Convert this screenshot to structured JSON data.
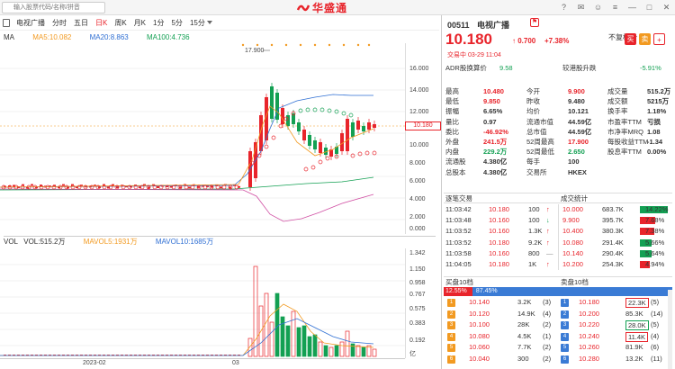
{
  "search": {
    "placeholder": "输入股票代码/名称/拼音"
  },
  "brand": {
    "name": "华盛通",
    "color": "#e8242b"
  },
  "toolbar": {
    "stock": "电视广播",
    "items": [
      "分时",
      "五日",
      "日K",
      "周K",
      "月K",
      "1分",
      "5分",
      "15分"
    ],
    "active": "日K"
  },
  "ma": {
    "label": "MA",
    "ma5": "MA5:10.082",
    "ma20": "MA20:8.863",
    "ma100": "MA100:4.736",
    "fq": "不复权"
  },
  "vol": {
    "label": "VOL",
    "vol": "VOL:515.2万",
    "mavol5": "MAVOL5:1931万",
    "mavol10": "MAVOL10:1685万"
  },
  "price_axis": [
    "16.000",
    "14.000",
    "12.000",
    "10.000",
    "8.000",
    "6.000",
    "4.000",
    "2.000",
    "0.000"
  ],
  "vol_axis": [
    "1.342",
    "1.150",
    "0.958",
    "0.767",
    "0.575",
    "0.383",
    "0.192",
    "亿"
  ],
  "crosshair_price": "10.180",
  "peak_label": "17.900",
  "dates": [
    "2023-02",
    "03"
  ],
  "colors": {
    "up": "#e8242b",
    "down": "#13a053",
    "ma5": "#f29a21",
    "ma20": "#2f6fd3",
    "ma100": "#13a053"
  },
  "panel": {
    "code": "00511",
    "name": "电视广播",
    "price": "10.180",
    "change": "0.700",
    "pct": "+7.38%",
    "time": "交易中 03-29 11:04",
    "adr_label": "ADR股换算价",
    "adr_value": "9.58",
    "adr_cmp_label": "较港股升跌",
    "adr_cmp_value": "-5.91%",
    "stats": [
      [
        "最高",
        "10.480",
        "今开",
        "9.900",
        "成交量",
        "515.2万"
      ],
      [
        "最低",
        "9.850",
        "昨收",
        "9.480",
        "成交额",
        "5215万"
      ],
      [
        "振幅",
        "6.65%",
        "均价",
        "10.121",
        "换手率",
        "1.18%"
      ],
      [
        "量比",
        "0.97",
        "流通市值",
        "44.59亿",
        "市盈率TTM",
        "亏损"
      ],
      [
        "委比",
        "-46.92%",
        "总市值",
        "44.59亿",
        "市净率MRQ",
        "1.08"
      ],
      [
        "外盘",
        "241.5万",
        "52周最高",
        "17.900",
        "每股收益TTM",
        "-1.34"
      ],
      [
        "内盘",
        "229.2万",
        "52周最低",
        "2.650",
        "股息率TTM",
        "0.00%"
      ],
      [
        "流通股",
        "4.380亿",
        "每手",
        "100",
        "",
        ""
      ],
      [
        "总股本",
        "4.380亿",
        "交易所",
        "HKEX",
        "",
        ""
      ]
    ],
    "trades_title": "逐笔交易",
    "tstats_title": "成交统计",
    "trades": [
      [
        "11:03:42",
        "10.180",
        "100",
        "up"
      ],
      [
        "11:03:48",
        "10.160",
        "100",
        "down"
      ],
      [
        "11:03:52",
        "10.160",
        "1.3K",
        "up"
      ],
      [
        "11:03:52",
        "10.180",
        "9.2K",
        "up"
      ],
      [
        "11:03:58",
        "10.160",
        "800",
        "flat"
      ],
      [
        "11:04:05",
        "10.180",
        "1K",
        "up"
      ]
    ],
    "tstats": [
      [
        "10.000",
        "683.7K",
        "14.22%",
        0.9
      ],
      [
        "9.900",
        "395.7K",
        "7.68%",
        0.5
      ],
      [
        "10.400",
        "380.3K",
        "7.38%",
        0.48
      ],
      [
        "10.080",
        "291.4K",
        "5.66%",
        0.37
      ],
      [
        "10.140",
        "290.4K",
        "5.64%",
        0.37
      ],
      [
        "10.200",
        "254.3K",
        "4.94%",
        0.32
      ]
    ],
    "buy_title": "买盘10档",
    "sell_title": "卖盘10档",
    "buy_ratio": "12.55%",
    "sell_ratio": "87.45%",
    "buy_ratio_value": 0.1255,
    "bids": [
      [
        "1",
        "10.140",
        "3.2K",
        "(3)"
      ],
      [
        "2",
        "10.120",
        "14.9K",
        "(4)"
      ],
      [
        "3",
        "10.100",
        "28K",
        "(2)"
      ],
      [
        "4",
        "10.080",
        "4.5K",
        "(1)"
      ],
      [
        "5",
        "10.060",
        "7.7K",
        "(2)"
      ],
      [
        "6",
        "10.040",
        "300",
        "(2)"
      ]
    ],
    "asks": [
      [
        "1",
        "10.180",
        "22.3K",
        "(5)"
      ],
      [
        "2",
        "10.200",
        "85.3K",
        "(14)"
      ],
      [
        "3",
        "10.220",
        "28.0K",
        "(5)"
      ],
      [
        "4",
        "10.240",
        "11.4K",
        "(4)"
      ],
      [
        "5",
        "10.260",
        "81.9K",
        "(6)"
      ],
      [
        "6",
        "10.280",
        "13.2K",
        "(11)"
      ]
    ]
  }
}
